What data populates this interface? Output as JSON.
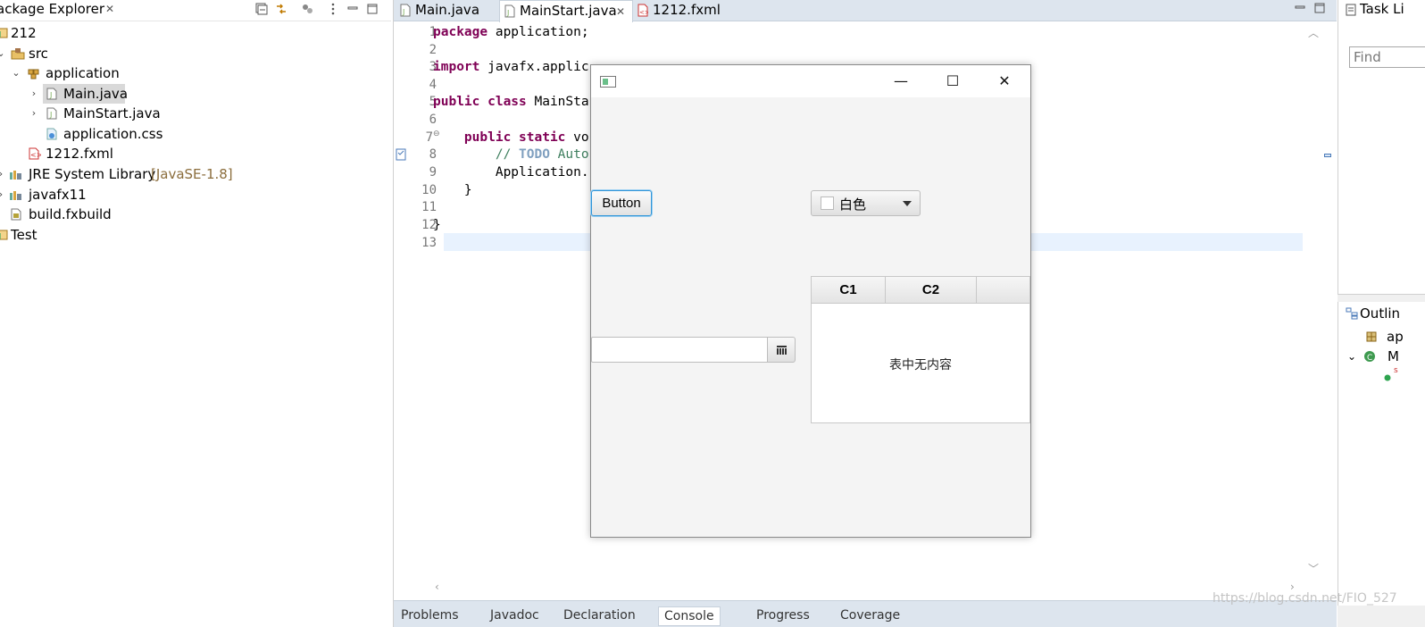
{
  "package_explorer": {
    "title": "ackage Explorer",
    "tree": [
      {
        "label": "212",
        "suffix": ""
      },
      {
        "label": "src",
        "suffix": ""
      },
      {
        "label": "application",
        "suffix": ""
      },
      {
        "label": "Main.java",
        "suffix": ""
      },
      {
        "label": "MainStart.java",
        "suffix": ""
      },
      {
        "label": "application.css",
        "suffix": ""
      },
      {
        "label": "1212.fxml",
        "suffix": ""
      },
      {
        "label": "JRE System Library",
        "suffix": "[JavaSE-1.8]"
      },
      {
        "label": "javafx11",
        "suffix": ""
      },
      {
        "label": "build.fxbuild",
        "suffix": ""
      },
      {
        "label": "Test",
        "suffix": ""
      }
    ]
  },
  "editor": {
    "tabs": [
      {
        "label": "Main.java"
      },
      {
        "label": "MainStart.java"
      },
      {
        "label": "1212.fxml"
      }
    ],
    "line_numbers": [
      "1",
      "2",
      "3",
      "4",
      "5",
      "6",
      "7",
      "8",
      "9",
      "10",
      "11",
      "12",
      "13"
    ],
    "code": {
      "l1_kw": "package",
      "l1_rest": " application;",
      "l3_kw": "import",
      "l3_rest": " javafx.applic",
      "l5_kw": "public class",
      "l5_rest": " MainSta",
      "l7_kw": "    public static",
      "l7_rest": " vo",
      "l8_c1": "        // ",
      "l8_todo": "TODO",
      "l8_c2": " Auto",
      "l9": "        Application.",
      "l10": "    }",
      "l12": "}"
    },
    "bottom_tabs": [
      "Problems",
      "Javadoc",
      "Declaration",
      "Console",
      "Progress",
      "Coverage"
    ]
  },
  "right_panels": {
    "task_title": "Task Li",
    "find_placeholder": "Find",
    "outline_title": "Outlin",
    "outline_items": [
      "ap",
      "M",
      "s"
    ]
  },
  "fx_window": {
    "window_controls": {
      "minimize": "—",
      "maximize": "☐",
      "close": "✕"
    },
    "button_label": "Button",
    "color_picker_label": "白色",
    "table_columns": [
      "C1",
      "C2",
      ""
    ],
    "table_placeholder": "表中无内容",
    "date_value": ""
  },
  "watermark": "https://blog.csdn.net/FIO_527"
}
